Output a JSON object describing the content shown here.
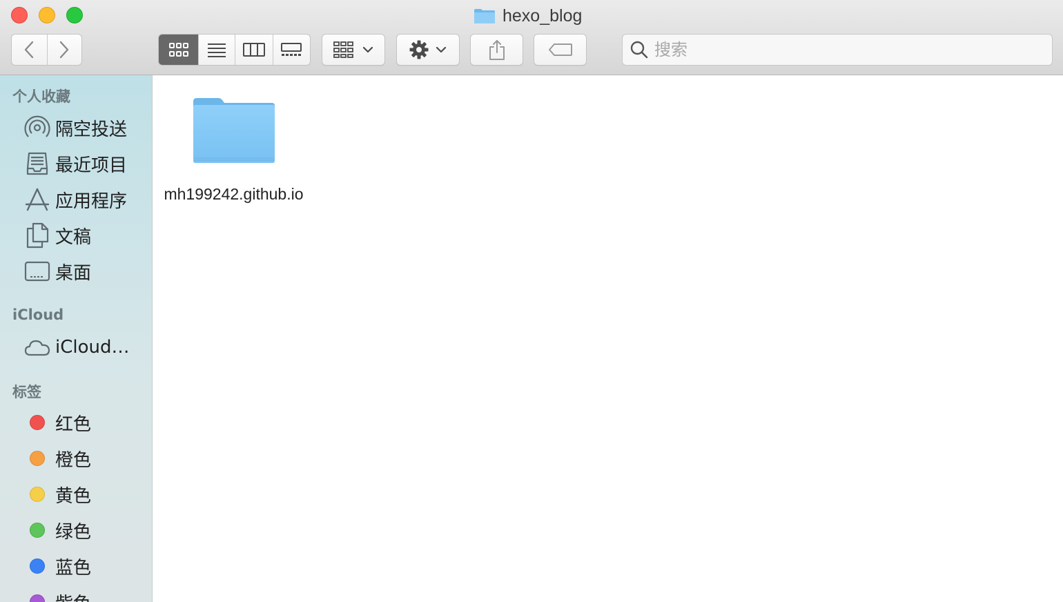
{
  "window": {
    "title": "hexo_blog"
  },
  "toolbar": {
    "colors": {
      "active_view": "#686868"
    }
  },
  "search": {
    "placeholder": "搜索"
  },
  "sidebar": {
    "favorites_header": "个人收藏",
    "favorites": [
      {
        "label": "隔空投送",
        "icon": "airdrop-icon"
      },
      {
        "label": "最近项目",
        "icon": "recents-icon"
      },
      {
        "label": "应用程序",
        "icon": "applications-icon"
      },
      {
        "label": "文稿",
        "icon": "documents-icon"
      },
      {
        "label": "桌面",
        "icon": "desktop-icon"
      }
    ],
    "icloud_header": "iCloud",
    "icloud": [
      {
        "label": "iCloud…",
        "icon": "cloud-icon"
      }
    ],
    "tags_header": "标签",
    "tags": [
      {
        "label": "红色",
        "color": "#f0524f"
      },
      {
        "label": "橙色",
        "color": "#f5a043"
      },
      {
        "label": "黄色",
        "color": "#f6cf48"
      },
      {
        "label": "绿色",
        "color": "#5ec55a"
      },
      {
        "label": "蓝色",
        "color": "#3b82f4"
      },
      {
        "label": "紫色",
        "color": "#a65ad5"
      }
    ]
  },
  "content": {
    "items": [
      {
        "name": "mh199242.github.io",
        "type": "folder"
      }
    ]
  }
}
